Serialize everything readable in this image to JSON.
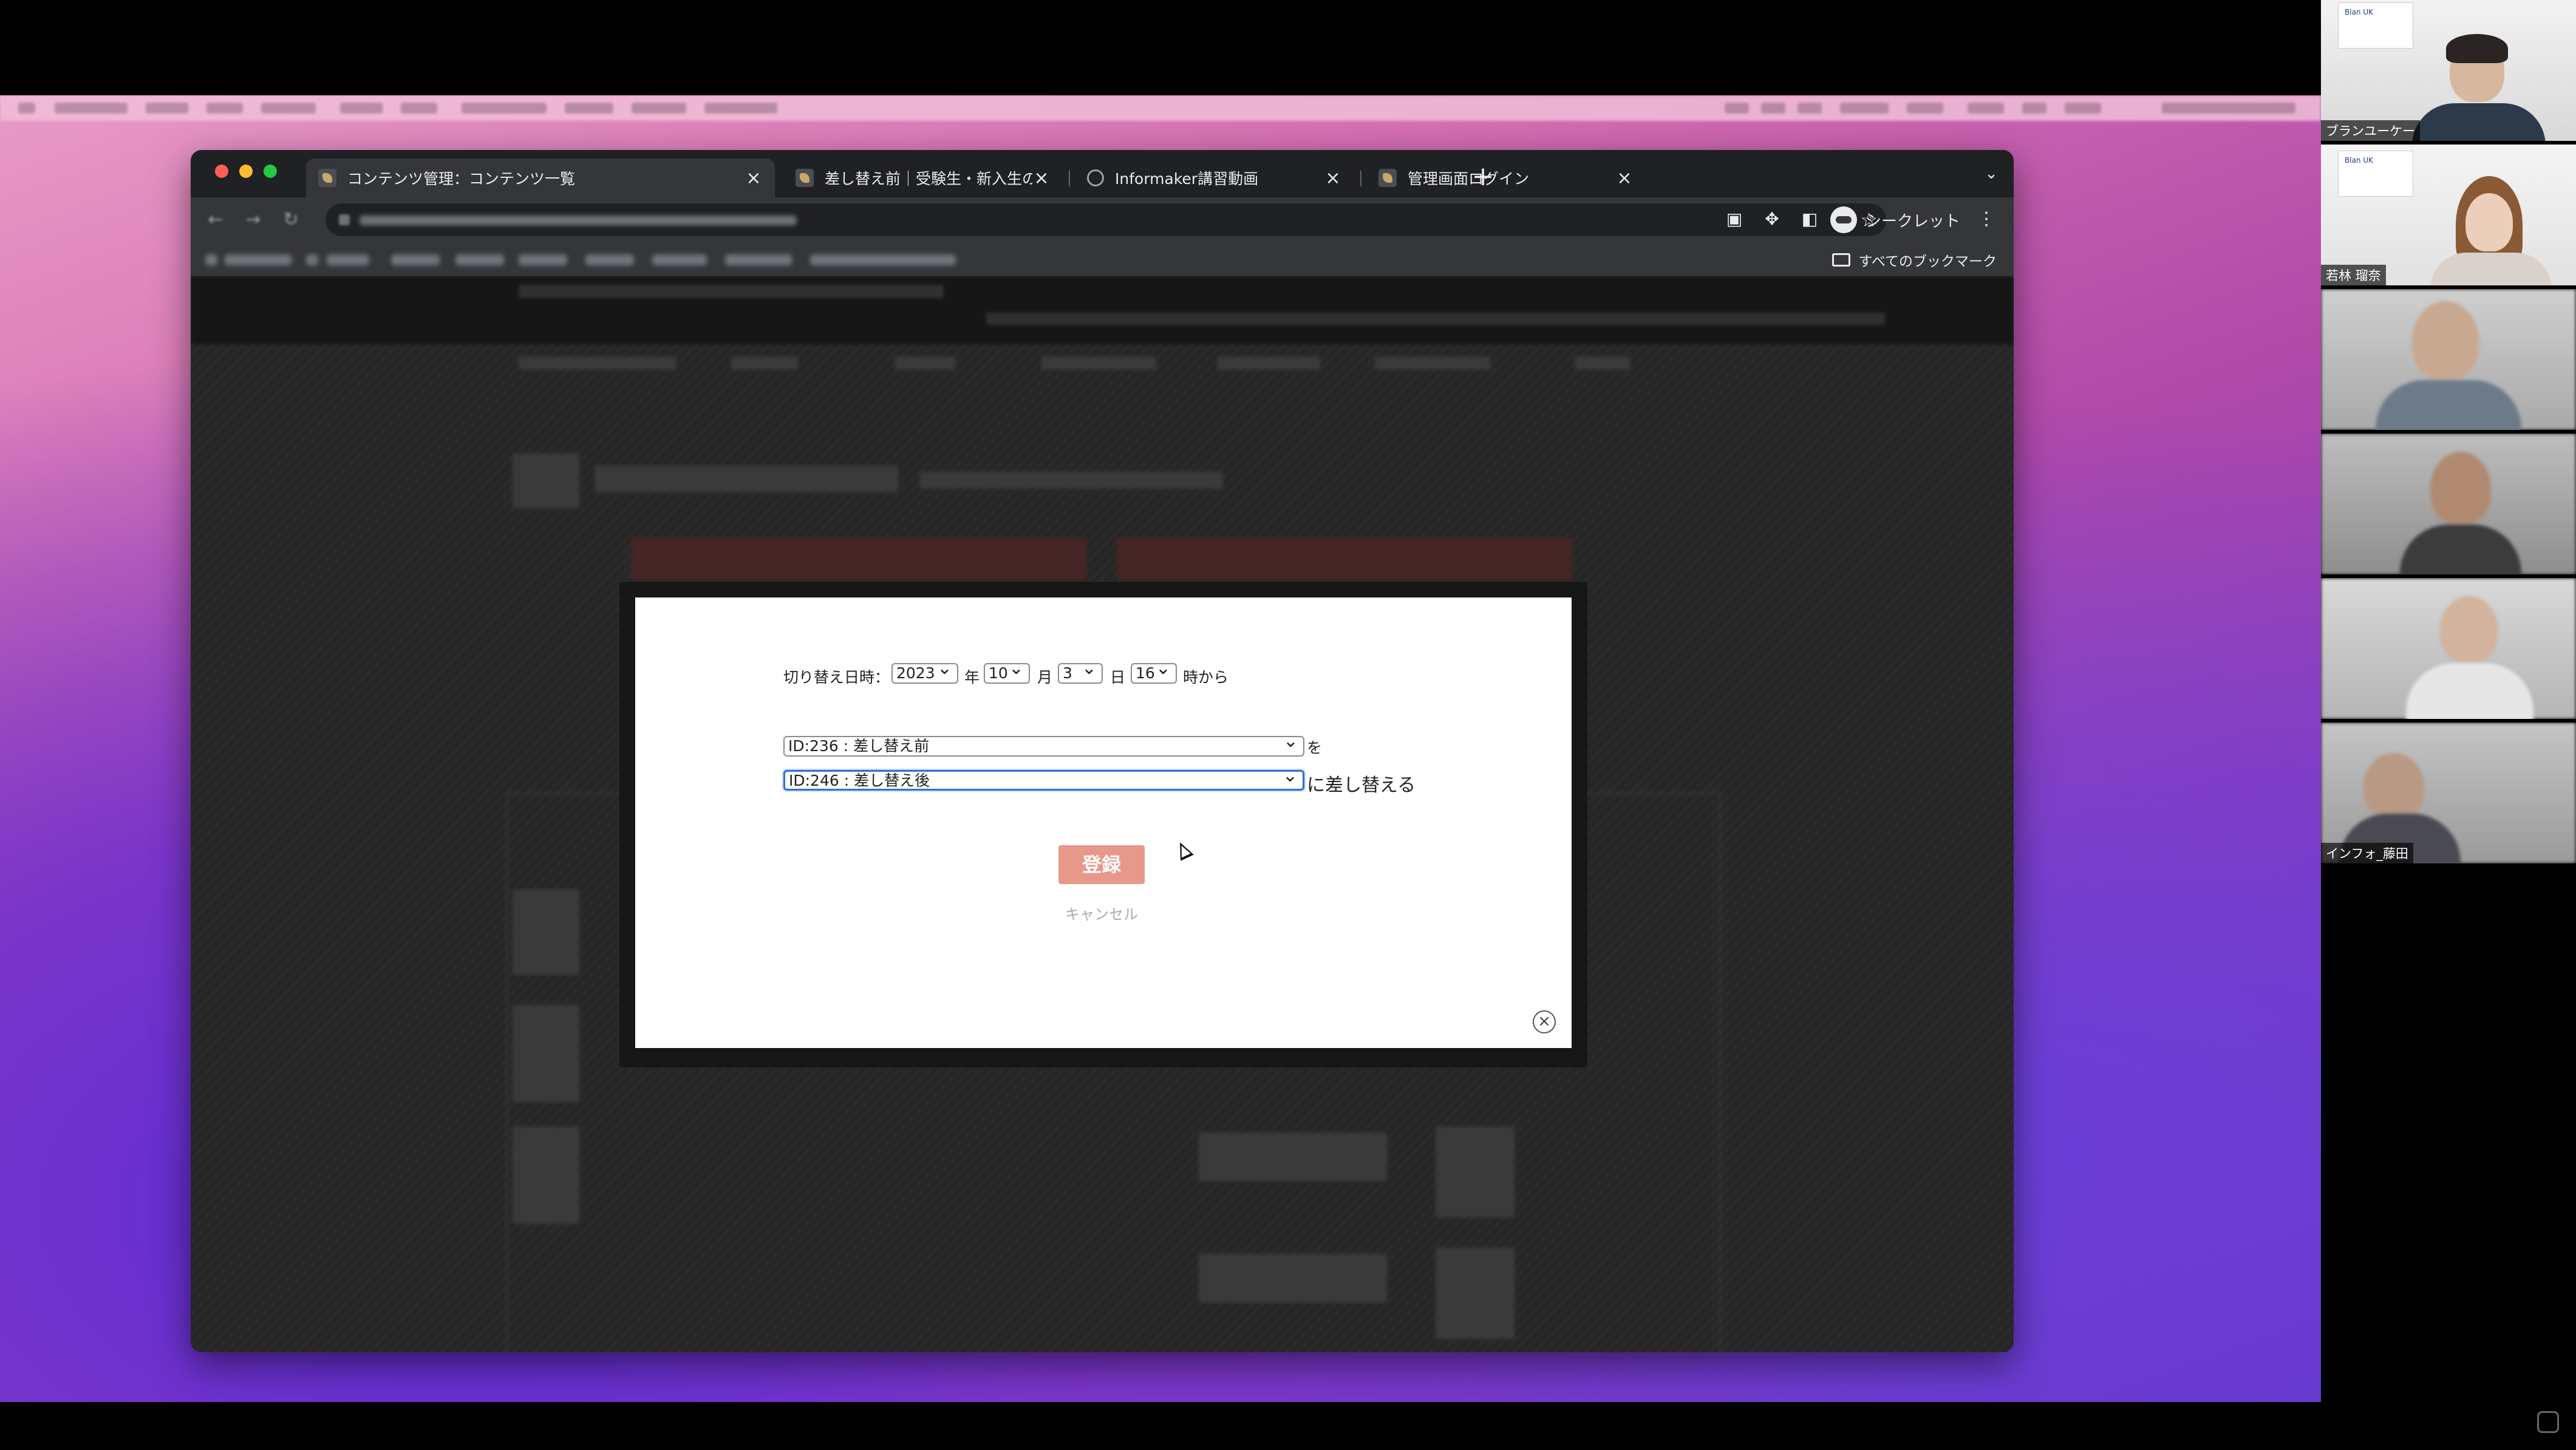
{
  "browser": {
    "tabs": [
      {
        "title": "コンテンツ管理：コンテンツ一覧",
        "icon": "site-favicon",
        "active": true
      },
      {
        "title": "差し替え前｜受験生・新入生の方へ",
        "icon": "site-favicon",
        "active": false
      },
      {
        "title": "Informaker講習動画",
        "icon": "globe-icon",
        "active": false
      },
      {
        "title": "管理画面ログイン",
        "icon": "site-favicon",
        "active": false
      }
    ],
    "profile_label": "シークレット",
    "all_bookmarks_label": "すべてのブックマーク"
  },
  "modal": {
    "switch_label": "切り替え日時：",
    "year_value": "2023",
    "year_unit": "年",
    "month_value": "10",
    "month_unit": "月",
    "day_value": "3",
    "day_unit": "日",
    "hour_value": "16",
    "hour_suffix": "時から",
    "source_value": "ID:236 : 差し替え前",
    "source_suffix": "を",
    "target_value": "ID:246 : 差し替え後",
    "target_suffix": "に差し替える",
    "register_label": "登録",
    "cancel_label": "キャンセル",
    "close_glyph": "×"
  },
  "participants": [
    {
      "name": "ブランユーケー",
      "logo": "Blan UK"
    },
    {
      "name": "若林 瑠奈",
      "logo": "Blan UK"
    },
    {
      "name": "",
      "logo": ""
    },
    {
      "name": "",
      "logo": ""
    },
    {
      "name": "",
      "logo": ""
    },
    {
      "name": "インフォ_藤田",
      "logo": ""
    }
  ],
  "colors": {
    "register_button": "#e8988a",
    "focus_ring": "#2f6fdc",
    "browser_chrome": "#35363a"
  }
}
